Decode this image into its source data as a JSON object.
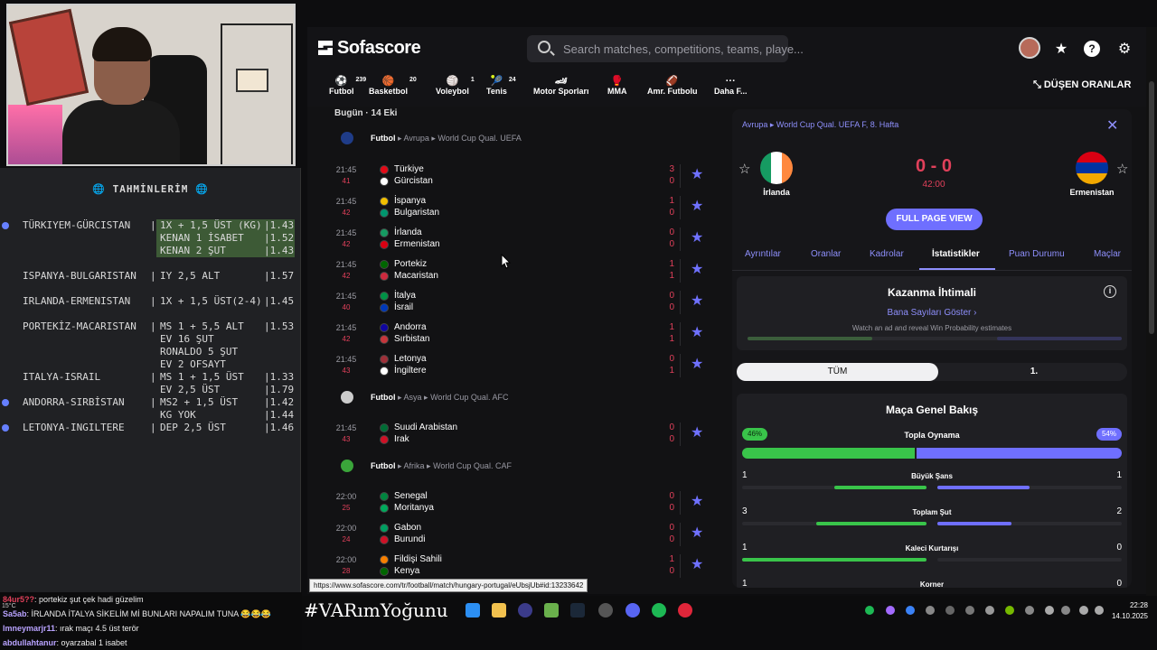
{
  "overlay": {
    "predictions_title": "🌐 TAHMİNLERİM 🌐",
    "predictions": [
      {
        "match": "TÜRKIYEM-GÜRCISTAN",
        "bet": "1X + 1,5 ÜST (KG)",
        "odd": "1.43",
        "dot": true,
        "hl": true
      },
      {
        "match": "",
        "bet": "KENAN 1 İSABET",
        "odd": "1.52",
        "dot": false,
        "hl": true
      },
      {
        "match": "",
        "bet": "KENAN 2 ŞUT",
        "odd": "1.43",
        "dot": false,
        "hl": true
      },
      {
        "match": "ISPANYA-BULGARISTAN",
        "bet": "IY 2,5 ALT",
        "odd": "1.57",
        "dot": false,
        "hl": false
      },
      {
        "match": "IRLANDA-ERMENISTAN",
        "bet": "1X + 1,5 ÜST(2-4)",
        "odd": "1.45",
        "dot": false,
        "hl": false
      },
      {
        "match": "PORTEKİZ-MACARISTAN",
        "bet": "MS 1 + 5,5 ALT",
        "odd": "1.53",
        "dot": false,
        "hl": false
      },
      {
        "match": "",
        "bet": "RONALDO 5 ŞUT",
        "odd": "",
        "dot": false,
        "hl": false
      },
      {
        "match": "",
        "bet": "EV 2 OFSAYT",
        "odd": "",
        "dot": false,
        "hl": false
      },
      {
        "match": "ITALYA-ISRAIL",
        "bet": "MS 1 + 1,5 ÜST",
        "odd": "1.33",
        "dot": false,
        "hl": false
      },
      {
        "match": "",
        "bet": "EV 2,5 ÜST",
        "odd": "1.79",
        "dot": false,
        "hl": false
      },
      {
        "match": "ANDORRA-SIRBİSTAN",
        "bet": "MS2 + 1,5 ÜST",
        "odd": "1.42",
        "dot": true,
        "hl": false
      },
      {
        "match": "",
        "bet": "KG YOK",
        "odd": "1.44",
        "dot": false,
        "hl": false
      },
      {
        "match": "LETONYA-INGILTERE",
        "bet": "DEP 2,5 ÜST",
        "odd": "1.46",
        "dot": true,
        "hl": false
      }
    ],
    "predictions_extra": {
      "bet": "EV 16 ŞUT"
    },
    "chat": [
      {
        "user": "84ur5??",
        "msg": ": portekiz şut çek hadi güzelim"
      },
      {
        "user": "Sa5ab",
        "msg": ": İRLANDA İTALYA SİKELİM Mİ BUNLARI NAPALIM TUNA 😂😂😂"
      },
      {
        "user": "lmneymarjr11",
        "msg": ": ırak maçı 4.5 üst terör"
      },
      {
        "user": "abdullahtanur",
        "msg": ": oyarzabal 1 isabet"
      }
    ],
    "weather": "15°C",
    "hashtag": "#VARımYoğunu"
  },
  "app": {
    "brand": "Sofascore",
    "search_placeholder": "Search matches, competitions, teams, playe...",
    "sports": [
      {
        "label": "Futbol",
        "count": "239",
        "glyph": "⚽"
      },
      {
        "label": "Basketbol",
        "count": "20",
        "glyph": "🏀"
      },
      {
        "label": "Voleybol",
        "count": "1",
        "glyph": "🏐"
      },
      {
        "label": "Tenis",
        "count": "24",
        "glyph": "🎾"
      },
      {
        "label": "Motor Sporları",
        "count": "",
        "glyph": "🏎"
      },
      {
        "label": "MMA",
        "count": "",
        "glyph": "🥊"
      },
      {
        "label": "Amr. Futbolu",
        "count": "",
        "glyph": "🏈"
      },
      {
        "label": "Daha F...",
        "count": "",
        "glyph": "···"
      }
    ],
    "drops_label": "DÜŞEN ORANLAR",
    "date_header": "Bugün · 14 Eki",
    "leagues": [
      {
        "sport": "Futbol",
        "region": "Avrupa",
        "name": "World Cup Qual. UEFA",
        "color": "#1f3c88",
        "matches": [
          {
            "time": "21:45",
            "minute": "41",
            "home": "Türkiye",
            "away": "Gürcistan",
            "hs": "3",
            "as": "0",
            "hc": "#e30a17",
            "ac": "#ffffff"
          },
          {
            "time": "21:45",
            "minute": "42",
            "home": "İspanya",
            "away": "Bulgaristan",
            "hs": "1",
            "as": "0",
            "hc": "#f1bf00",
            "ac": "#00966e"
          },
          {
            "time": "21:45",
            "minute": "42",
            "home": "İrlanda",
            "away": "Ermenistan",
            "hs": "0",
            "as": "0",
            "hc": "#169b62",
            "ac": "#d90012"
          },
          {
            "time": "21:45",
            "minute": "42",
            "home": "Portekiz",
            "away": "Macaristan",
            "hs": "1",
            "as": "1",
            "hc": "#006600",
            "ac": "#cd2a3e"
          },
          {
            "time": "21:45",
            "minute": "40",
            "home": "İtalya",
            "away": "İsrail",
            "hs": "0",
            "as": "0",
            "hc": "#009246",
            "ac": "#0038b8"
          },
          {
            "time": "21:45",
            "minute": "42",
            "home": "Andorra",
            "away": "Sırbistan",
            "hs": "1",
            "as": "1",
            "hc": "#10069f",
            "ac": "#c6363c"
          },
          {
            "time": "21:45",
            "minute": "43",
            "home": "Letonya",
            "away": "İngiltere",
            "hs": "0",
            "as": "1",
            "hc": "#9e3039",
            "ac": "#ffffff"
          }
        ]
      },
      {
        "sport": "Futbol",
        "region": "Asya",
        "name": "World Cup Qual. AFC",
        "color": "#cccccc",
        "matches": [
          {
            "time": "21:45",
            "minute": "43",
            "home": "Suudi Arabistan",
            "away": "Irak",
            "hs": "0",
            "as": "0",
            "hc": "#006c35",
            "ac": "#ce1126"
          }
        ]
      },
      {
        "sport": "Futbol",
        "region": "Afrika",
        "name": "World Cup Qual. CAF",
        "color": "#3aa53a",
        "matches": [
          {
            "time": "22:00",
            "minute": "25",
            "home": "Senegal",
            "away": "Moritanya",
            "hs": "0",
            "as": "0",
            "hc": "#00853f",
            "ac": "#00a95c"
          },
          {
            "time": "22:00",
            "minute": "24",
            "home": "Gabon",
            "away": "Burundi",
            "hs": "0",
            "as": "0",
            "hc": "#009e60",
            "ac": "#ce1126"
          },
          {
            "time": "22:00",
            "minute": "28",
            "home": "Fildişi Sahili",
            "away": "Kenya",
            "hs": "1",
            "as": "0",
            "hc": "#f77f00",
            "ac": "#006600"
          }
        ]
      }
    ],
    "status_url": "https://www.sofascore.com/tr/football/match/hungary-portugal/eUbsjUb#id:13233642",
    "detail": {
      "breadcrumb": "Avrupa ▸ World Cup Qual. UEFA F, 8. Hafta",
      "home": "İrlanda",
      "away": "Ermenistan",
      "score": "0 - 0",
      "clock": "42:00",
      "full_page": "FULL PAGE VIEW",
      "tabs": [
        "Ayrıntılar",
        "Oranlar",
        "Kadrolar",
        "İstatistikler",
        "Puan Durumu",
        "Maçlar"
      ],
      "active_tab": "İstatistikler",
      "win_title": "Kazanma İhtimali",
      "win_link": "Bana Sayıları Göster",
      "win_sub": "Watch an ad and reveal Win Probability estimates",
      "seg_all": "TÜM",
      "seg_first": "1.",
      "overview_title": "Maça Genel Bakış",
      "possession": {
        "label": "Topla Oynama",
        "home": "46%",
        "away": "54%",
        "home_pct": 46
      },
      "stats": [
        {
          "label": "Büyük Şans",
          "home": "1",
          "away": "1"
        },
        {
          "label": "Toplam Şut",
          "home": "3",
          "away": "2"
        },
        {
          "label": "Kaleci Kurtarışı",
          "home": "1",
          "away": "0"
        },
        {
          "label": "Korner",
          "home": "1",
          "away": "0"
        }
      ]
    }
  },
  "taskbar": {
    "time": "22:28",
    "date": "14.10.2025"
  }
}
